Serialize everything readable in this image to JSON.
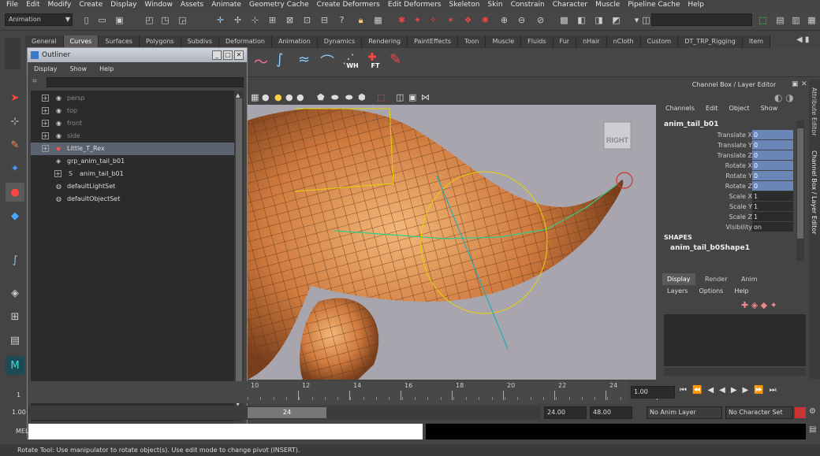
{
  "menubar": [
    "File",
    "Edit",
    "Modify",
    "Create",
    "Display",
    "Window",
    "Assets",
    "Animate",
    "Geometry Cache",
    "Create Deformers",
    "Edit Deformers",
    "Skeleton",
    "Skin",
    "Constrain",
    "Character",
    "Muscle",
    "Pipeline Cache",
    "Help"
  ],
  "statusline": {
    "mode": "Animation"
  },
  "shelf": {
    "tabs": [
      "General",
      "Curves",
      "Surfaces",
      "Polygons",
      "Subdivs",
      "Deformation",
      "Animation",
      "Dynamics",
      "Rendering",
      "PaintEffects",
      "Toon",
      "Muscle",
      "Fluids",
      "Fur",
      "nHair",
      "nCloth",
      "Custom",
      "DT_TRP_Rigging",
      "Item"
    ],
    "active": "Curves",
    "icon_labels": [
      "WH",
      "FT"
    ]
  },
  "outliner": {
    "title": "Outliner",
    "menu": [
      "Display",
      "Show",
      "Help"
    ],
    "items": [
      {
        "label": "persp",
        "icon": "camera-icon",
        "dim": true
      },
      {
        "label": "top",
        "icon": "camera-icon",
        "dim": true
      },
      {
        "label": "front",
        "icon": "camera-icon",
        "dim": true
      },
      {
        "label": "side",
        "icon": "camera-icon",
        "dim": true
      },
      {
        "label": "Little_T_Rex",
        "icon": "mesh-icon",
        "selected": true
      },
      {
        "label": "grp_anim_tail_b01",
        "icon": "group-icon"
      },
      {
        "label": "anim_tail_b01",
        "icon": "curve-icon"
      },
      {
        "label": "defaultLightSet",
        "icon": "set-icon"
      },
      {
        "label": "defaultObjectSet",
        "icon": "set-icon"
      }
    ]
  },
  "viewport": {
    "cube_label": "RIGHT"
  },
  "channelbox": {
    "title": "Channel Box / Layer Editor",
    "menu": [
      "Channels",
      "Edit",
      "Object",
      "Show"
    ],
    "object": "anim_tail_b01",
    "attributes": [
      {
        "label": "Translate X",
        "value": "0",
        "hl": true
      },
      {
        "label": "Translate Y",
        "value": "0",
        "hl": true
      },
      {
        "label": "Translate Z",
        "value": "0",
        "hl": true
      },
      {
        "label": "Rotate X",
        "value": "0",
        "hl": true
      },
      {
        "label": "Rotate Y",
        "value": "0",
        "hl": true
      },
      {
        "label": "Rotate Z",
        "value": "0",
        "hl": true
      },
      {
        "label": "Scale X",
        "value": "1",
        "hl": false
      },
      {
        "label": "Scale Y",
        "value": "1",
        "hl": false
      },
      {
        "label": "Scale Z",
        "value": "1",
        "hl": false
      },
      {
        "label": "Visibility",
        "value": "on",
        "hl": false
      }
    ],
    "shapes_header": "SHAPES",
    "shape": "anim_tail_b0Shape1",
    "side_tabs": [
      "Attribute Editor",
      "Channel Box / Layer Editor"
    ]
  },
  "layereditor": {
    "tabs": [
      "Display",
      "Render",
      "Anim"
    ],
    "active": "Display",
    "menu": [
      "Layers",
      "Options",
      "Help"
    ]
  },
  "timeslider": {
    "ticks": [
      "10",
      "12",
      "14",
      "16",
      "18",
      "20",
      "22",
      "24"
    ],
    "current": "1.00"
  },
  "rangeslider": {
    "start": "1.00",
    "range_end": "24",
    "end": "24.00",
    "anim_end": "48.00",
    "anim_layer": "No Anim Layer",
    "character": "No Character Set"
  },
  "cmdline": {
    "label": "MEL"
  },
  "helpline": "Rotate Tool: Use manipulator to rotate object(s). Use edit mode to change pivot (INSERT)."
}
